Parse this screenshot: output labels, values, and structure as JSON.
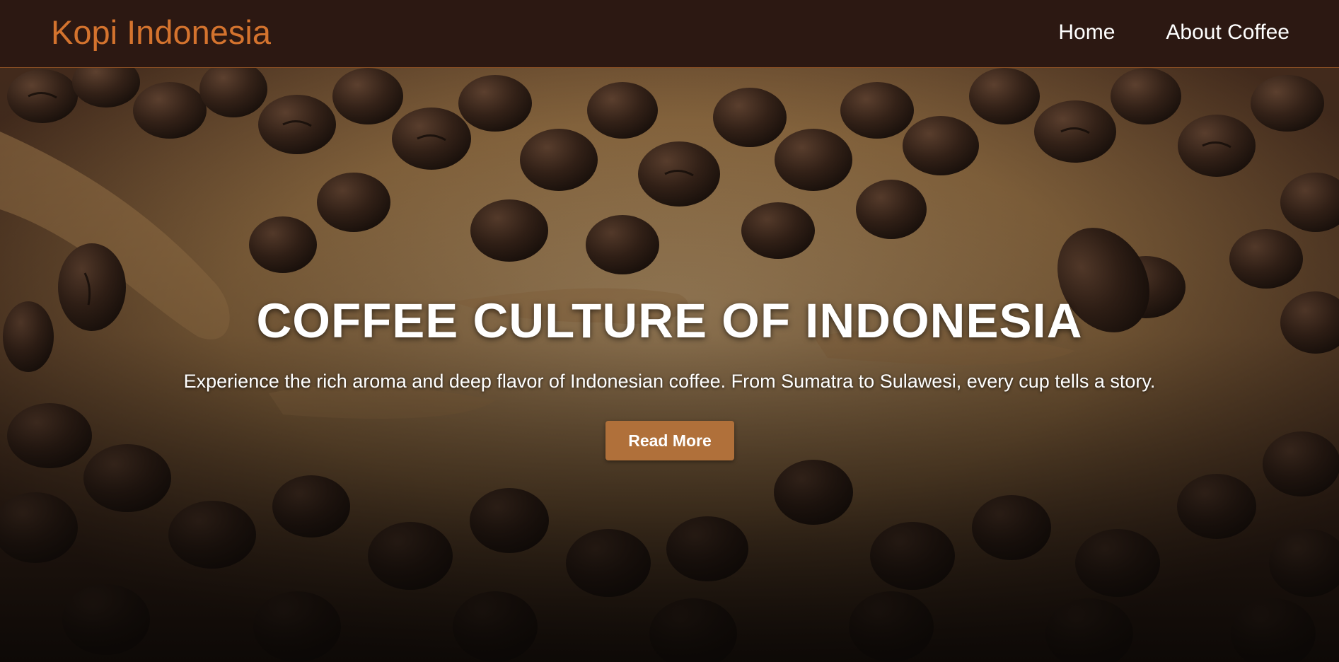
{
  "navbar": {
    "brand": "Kopi Indonesia",
    "links": [
      {
        "label": "Home"
      },
      {
        "label": "About Coffee"
      }
    ]
  },
  "hero": {
    "title": "COFFEE CULTURE OF INDONESIA",
    "subtitle": "Experience the rich aroma and deep flavor of Indonesian coffee. From Sumatra to Sulawesi, every cup tells a story.",
    "button_label": "Read More"
  },
  "colors": {
    "navbar_bg": "#2c1812",
    "brand": "#d4732e",
    "button_bg": "#b0703a",
    "text": "#ffffff"
  }
}
